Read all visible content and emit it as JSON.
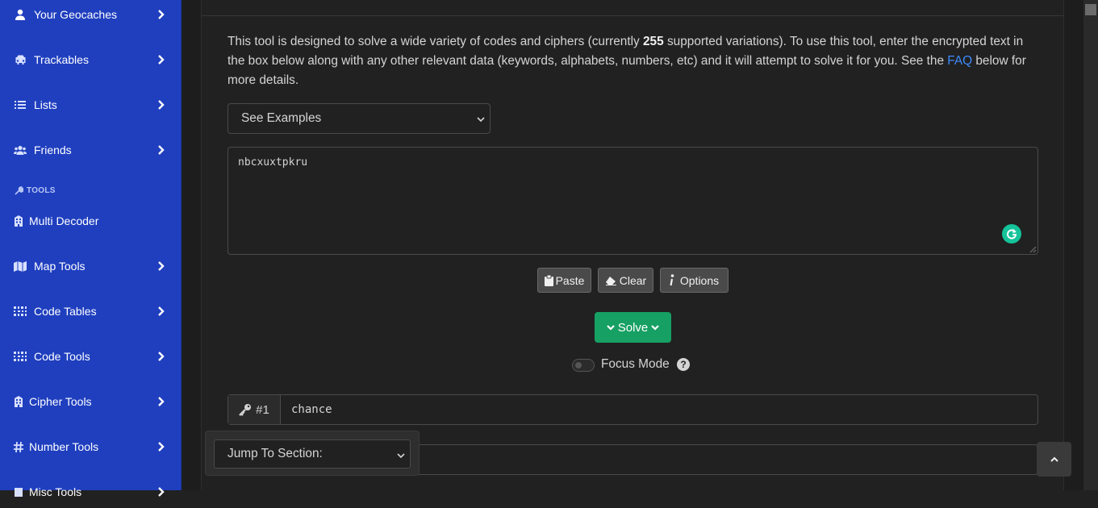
{
  "sidebar": {
    "items": [
      {
        "label": "Your Geocaches",
        "icon": "user-icon"
      },
      {
        "label": "Trackables",
        "icon": "car-icon"
      },
      {
        "label": "Lists",
        "icon": "list-icon"
      },
      {
        "label": "Friends",
        "icon": "users-icon"
      },
      {
        "label": "Multi Decoder",
        "icon": "building-icon"
      },
      {
        "label": "Map Tools",
        "icon": "map-icon"
      },
      {
        "label": "Code Tables",
        "icon": "grid-icon"
      },
      {
        "label": "Code Tools",
        "icon": "grid-icon"
      },
      {
        "label": "Cipher Tools",
        "icon": "building-icon"
      },
      {
        "label": "Number Tools",
        "icon": "hash-icon"
      },
      {
        "label": "Misc Tools",
        "icon": "misc-icon"
      }
    ],
    "section_label": "TOOLS"
  },
  "intro": {
    "text_1": "This tool is designed to solve a wide variety of codes and ciphers (currently ",
    "count": "255",
    "text_2": " supported variations). To use this tool, enter the encrypted text in the box below along with any other relevant data (keywords, alphabets, numbers, etc) and it will attempt to solve it for you. See the ",
    "faq_link": "FAQ",
    "text_3": " below for more details."
  },
  "examples_select": {
    "value": "See Examples"
  },
  "cipher_input": {
    "value": "nbcxuxtpkru"
  },
  "buttons": {
    "paste": "Paste",
    "clear": "Clear",
    "options": "Options",
    "solve": "Solve"
  },
  "focus_mode": {
    "label": "Focus Mode",
    "enabled": false
  },
  "keyword_1": {
    "label": "#1",
    "value": "chance"
  },
  "jump_select": {
    "value": "Jump To Section:"
  },
  "colors": {
    "sidebar": "#1f3fbf",
    "solve": "#16a063",
    "link": "#3d8bfd",
    "background": "#212121"
  }
}
